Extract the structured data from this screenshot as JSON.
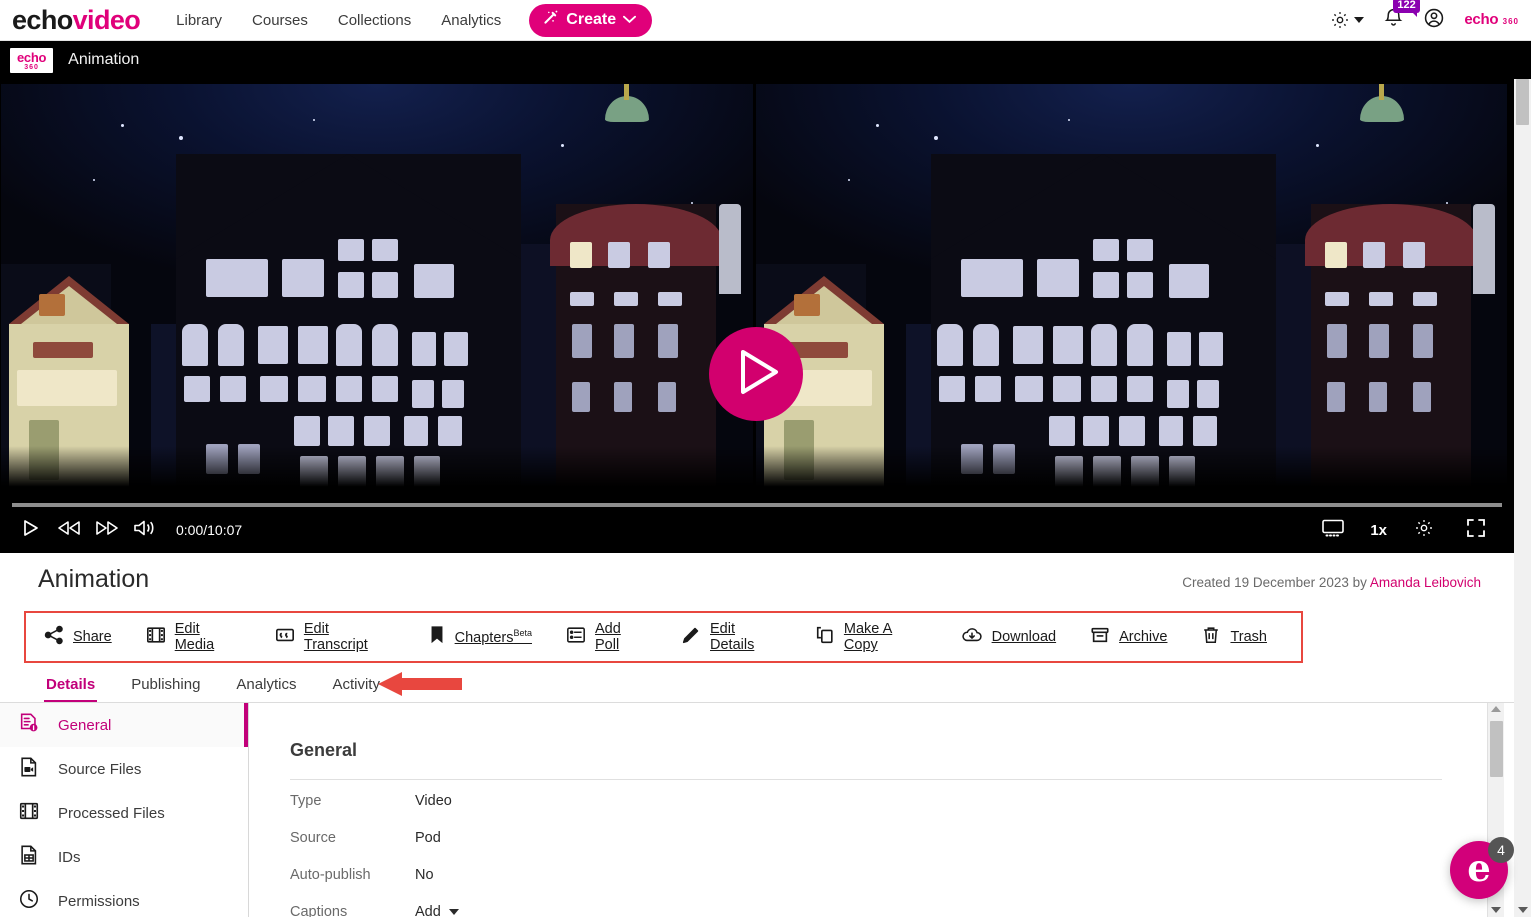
{
  "topnav": {
    "brand_echo": "echo",
    "brand_video": "video",
    "links": [
      {
        "label": "Library"
      },
      {
        "label": "Courses"
      },
      {
        "label": "Collections"
      },
      {
        "label": "Analytics"
      }
    ],
    "create_label": "Create",
    "notification_count": "122",
    "logo_line1": "echo",
    "logo_line2": "360"
  },
  "breadcrumb": {
    "logo_line1": "echo",
    "logo_line2": "360",
    "title": "Animation"
  },
  "player": {
    "timecode": "0:00/10:07",
    "current_time": "0:00",
    "duration": "10:07",
    "speed": "1x"
  },
  "detail": {
    "title": "Animation",
    "created_prefix": "Created 19 December 2023 by ",
    "created_date": "19 December 2023",
    "author": "Amanda Leibovich"
  },
  "actions": [
    {
      "label": "Share",
      "icon": "share-icon"
    },
    {
      "label": "Edit Media",
      "icon": "film-icon"
    },
    {
      "label": "Edit Transcript",
      "icon": "quote-icon"
    },
    {
      "label": "Chapters",
      "badge": "Beta",
      "icon": "bookmark-icon"
    },
    {
      "label": "Add Poll",
      "icon": "list-icon"
    },
    {
      "label": "Edit Details",
      "icon": "pencil-icon"
    },
    {
      "label": "Make A Copy",
      "icon": "copy-icon"
    },
    {
      "label": "Download",
      "icon": "cloud-download-icon"
    },
    {
      "label": "Archive",
      "icon": "archive-box-icon"
    },
    {
      "label": "Trash",
      "icon": "trash-icon"
    }
  ],
  "tabs": [
    {
      "label": "Details",
      "active": true
    },
    {
      "label": "Publishing",
      "active": false
    },
    {
      "label": "Analytics",
      "active": false
    },
    {
      "label": "Activity",
      "active": false
    }
  ],
  "sidebar": {
    "items": [
      {
        "label": "General",
        "icon": "document-info-icon",
        "active": true
      },
      {
        "label": "Source Files",
        "icon": "video-file-icon",
        "active": false
      },
      {
        "label": "Processed Files",
        "icon": "film-file-icon",
        "active": false
      },
      {
        "label": "IDs",
        "icon": "id-file-icon",
        "active": false
      },
      {
        "label": "Permissions",
        "icon": "permissions-icon",
        "active": false
      }
    ]
  },
  "general_panel": {
    "heading": "General",
    "fields": [
      {
        "label": "Type",
        "value": "Video",
        "has_chevron": false
      },
      {
        "label": "Source",
        "value": "Pod",
        "has_chevron": false
      },
      {
        "label": "Auto-publish",
        "value": "No",
        "has_chevron": false
      },
      {
        "label": "Captions",
        "value": "Add",
        "has_chevron": true
      }
    ]
  },
  "chat_widget": {
    "badge": "4",
    "letter": "e"
  },
  "colors": {
    "brand_pink": "#e0007a",
    "accent_pink": "#c2007a",
    "play_pink": "#d2006e",
    "annotation_red": "#e8473f",
    "badge_purple": "#8b00b0"
  }
}
